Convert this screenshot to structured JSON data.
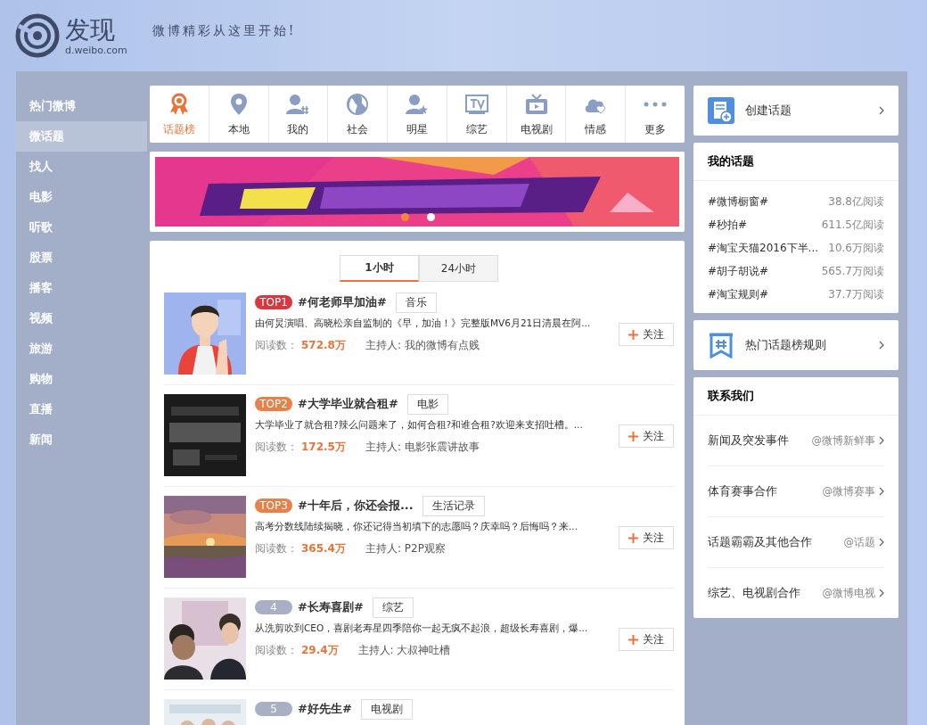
{
  "header": {
    "logo_title": "发现",
    "logo_domain": "d.weibo.com",
    "slogan": "微博精彩从这里开始!"
  },
  "sidebar": {
    "items": [
      {
        "label": "热门微博",
        "selected": false
      },
      {
        "label": "微话题",
        "selected": true
      },
      {
        "label": "找人",
        "selected": false
      },
      {
        "label": "电影",
        "selected": false
      },
      {
        "label": "听歌",
        "selected": false
      },
      {
        "label": "股票",
        "selected": false
      },
      {
        "label": "播客",
        "selected": false
      },
      {
        "label": "视频",
        "selected": false
      },
      {
        "label": "旅游",
        "selected": false
      },
      {
        "label": "购物",
        "selected": false
      },
      {
        "label": "直播",
        "selected": false
      },
      {
        "label": "新闻",
        "selected": false
      }
    ]
  },
  "categories": [
    {
      "label": "话题榜",
      "selected": true
    },
    {
      "label": "本地",
      "selected": false
    },
    {
      "label": "我的",
      "selected": false
    },
    {
      "label": "社会",
      "selected": false
    },
    {
      "label": "明星",
      "selected": false
    },
    {
      "label": "综艺",
      "selected": false
    },
    {
      "label": "电视剧",
      "selected": false
    },
    {
      "label": "情感",
      "selected": false
    },
    {
      "label": "更多",
      "selected": false
    }
  ],
  "banner": {
    "dots": [
      {
        "selected": true
      },
      {
        "selected": false
      }
    ]
  },
  "time_tabs": [
    {
      "label": "1小时",
      "selected": true
    },
    {
      "label": "24小时",
      "selected": false
    }
  ],
  "topics": [
    {
      "rank": "TOP1",
      "color": "#d9363e",
      "title": "#何老师早加油#",
      "tag": "音乐",
      "description": "由何炅演唱、高晓松亲自监制的《早，加油！》完整版MV6月21日清晨在阿...",
      "reads_label": "阅读数：",
      "reads": "572.8万",
      "host": "主持人: 我的微博有点贱",
      "follow": "关注"
    },
    {
      "rank": "TOP2",
      "color": "#e8804a",
      "title": "#大学毕业就合租#",
      "tag": "电影",
      "description": "大学毕业了就合租?辣么问题来了，如何合租?和谁合租?欢迎来支招吐槽。...",
      "reads_label": "阅读数：",
      "reads": "172.5万",
      "host": "主持人: 电影张震讲故事",
      "follow": "关注"
    },
    {
      "rank": "TOP3",
      "color": "#e8804a",
      "title": "#十年后，你还会报...",
      "tag": "生活记录",
      "description": "高考分数线陆续揭晓，你还记得当初填下的志愿吗？庆幸吗？后悔吗？来...",
      "reads_label": "阅读数：",
      "reads": "365.4万",
      "host": "主持人: P2P观察",
      "follow": "关注"
    },
    {
      "rank": "4",
      "color": "#a9b0c6",
      "title": "#长寿喜剧#",
      "tag": "综艺",
      "description": "从洗剪吹到CEO，喜剧老寿星四季陪你一起无疯不起浪，超级长寿喜剧，爆...",
      "reads_label": "阅读数：",
      "reads": "29.4万",
      "host": "主持人: 大叔神吐槽",
      "follow": "关注"
    },
    {
      "rank": "5",
      "color": "#a9b0c6",
      "title": "#好先生#",
      "tag": "电视剧"
    }
  ],
  "create_topic": {
    "label": "创建话题"
  },
  "my_topics": {
    "title": "我的话题",
    "items": [
      {
        "name": "#微博橱窗#",
        "reads": "38.8亿阅读"
      },
      {
        "name": "#秒拍#",
        "reads": "611.5亿阅读"
      },
      {
        "name": "#淘宝天猫2016下半...",
        "reads": "10.6万阅读"
      },
      {
        "name": "#胡子胡说#",
        "reads": "565.7万阅读"
      },
      {
        "name": "#淘宝规则#",
        "reads": "37.7万阅读"
      }
    ]
  },
  "rules": {
    "label": "热门话题榜规则"
  },
  "contact": {
    "title": "联系我们",
    "items": [
      {
        "label": "新闻及突发事件",
        "account": "@微博新鲜事"
      },
      {
        "label": "体育赛事合作",
        "account": "@微博赛事"
      },
      {
        "label": "话题霸霸及其他合作",
        "account": "@话题"
      },
      {
        "label": "综艺、电视剧合作",
        "account": "@微博电视"
      }
    ]
  }
}
